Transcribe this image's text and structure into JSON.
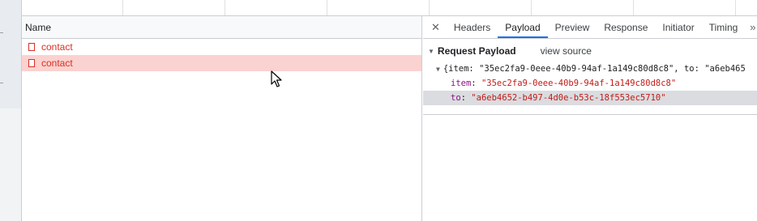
{
  "request_list": {
    "column_name": "Name",
    "rows": [
      {
        "name": "contact",
        "selected": false
      },
      {
        "name": "contact",
        "selected": true
      }
    ]
  },
  "details": {
    "close_glyph": "✕",
    "tabs": [
      "Headers",
      "Payload",
      "Preview",
      "Response",
      "Initiator",
      "Timing"
    ],
    "active_tab": "Payload",
    "more_glyph": "»",
    "payload": {
      "section_title": "Request Payload",
      "view_source": "view source",
      "summary": "{item: \"35ec2fa9-0eee-40b9-94af-1a149c80d8c8\", to: \"a6eb465",
      "fields": [
        {
          "key": "item",
          "value": "\"35ec2fa9-0eee-40b9-94af-1a149c80d8c8\""
        },
        {
          "key": "to",
          "value": "\"a6eb4652-b497-4d0e-b53c-18f553ec5710\""
        }
      ]
    }
  },
  "colors": {
    "error_red": "#d93025",
    "selected_row": "#fad2cf",
    "active_tab_underline": "#1a73e8",
    "json_key": "#881280",
    "json_string": "#c41a16"
  }
}
